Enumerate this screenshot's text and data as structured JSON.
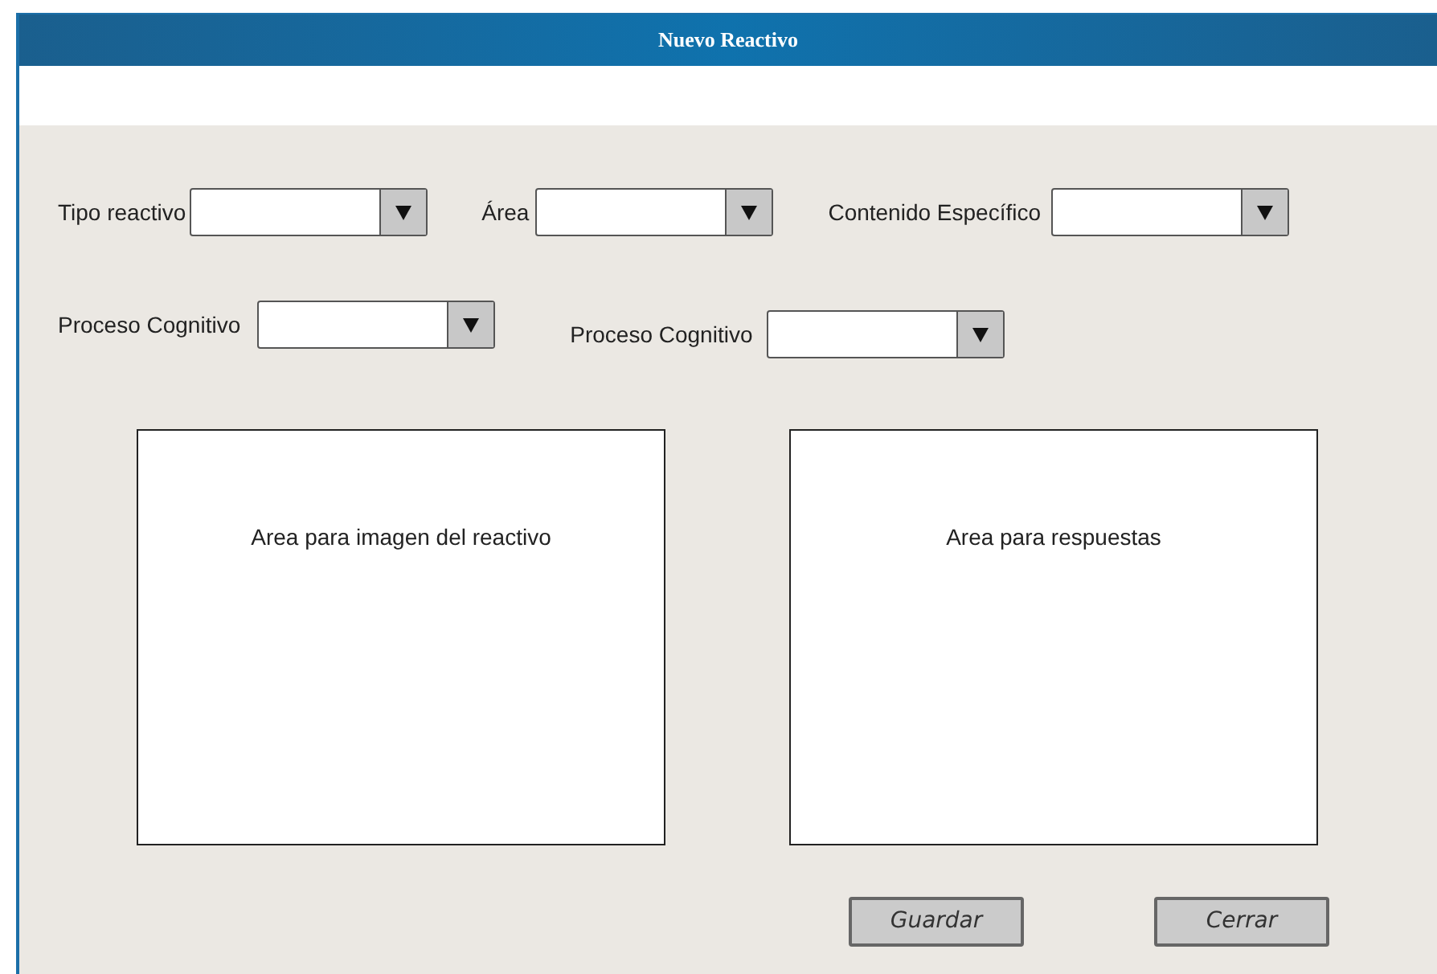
{
  "window": {
    "title": "Nuevo Reactivo"
  },
  "filters": [
    {
      "label": "Tipo reactivo"
    },
    {
      "label": "Área"
    },
    {
      "label": "Contenido Específico"
    },
    {
      "label": "Proceso Cognitivo"
    },
    {
      "label": "Proceso Cognitivo"
    }
  ],
  "panels": [
    {
      "text": "Area para imagen del reactivo"
    },
    {
      "text": "Area para respuestas"
    }
  ],
  "buttons": [
    {
      "label": "Guardar"
    },
    {
      "label": "Cerrar"
    }
  ]
}
